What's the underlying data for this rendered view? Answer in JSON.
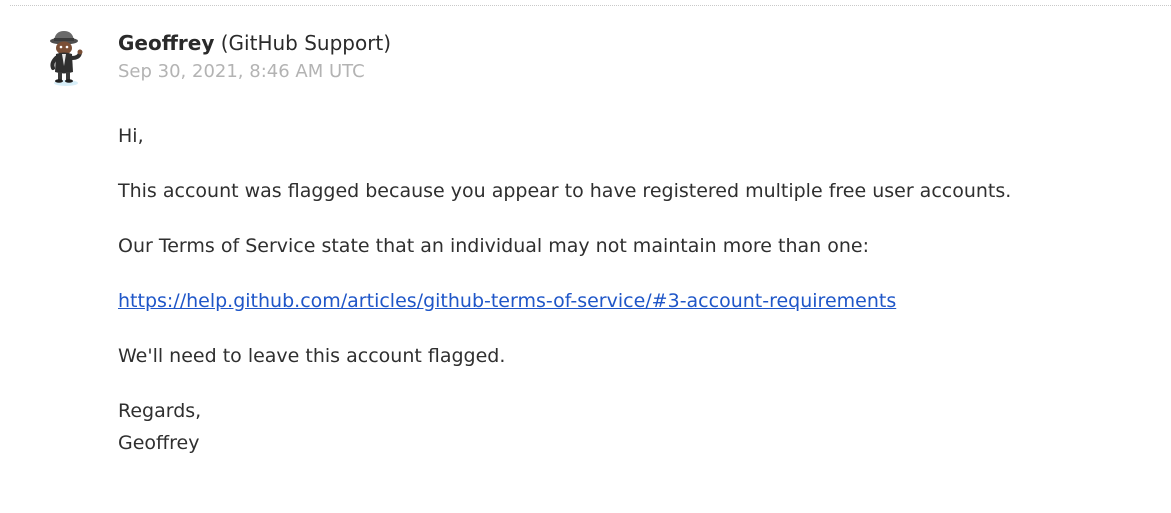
{
  "message": {
    "author_name": "Geoffrey",
    "author_org": " (GitHub Support)",
    "timestamp": "Sep 30, 2021, 8:46 AM UTC",
    "avatar_icon": "detective-octocat-avatar",
    "greeting": "Hi,",
    "paragraph_1": "This account was flagged because you appear to have registered multiple free user accounts.",
    "paragraph_2": "Our Terms of Service state that an individual may not maintain more than one:",
    "link_text": "https://help.github.com/articles/github-terms-of-service/#3-account-requirements",
    "paragraph_3": "We'll need to leave this account flagged.",
    "closing": "Regards,",
    "signature": "Geoffrey"
  },
  "colors": {
    "link": "#1f56c8",
    "timestamp": "#b3b3b3",
    "text": "#2f2f2f"
  }
}
